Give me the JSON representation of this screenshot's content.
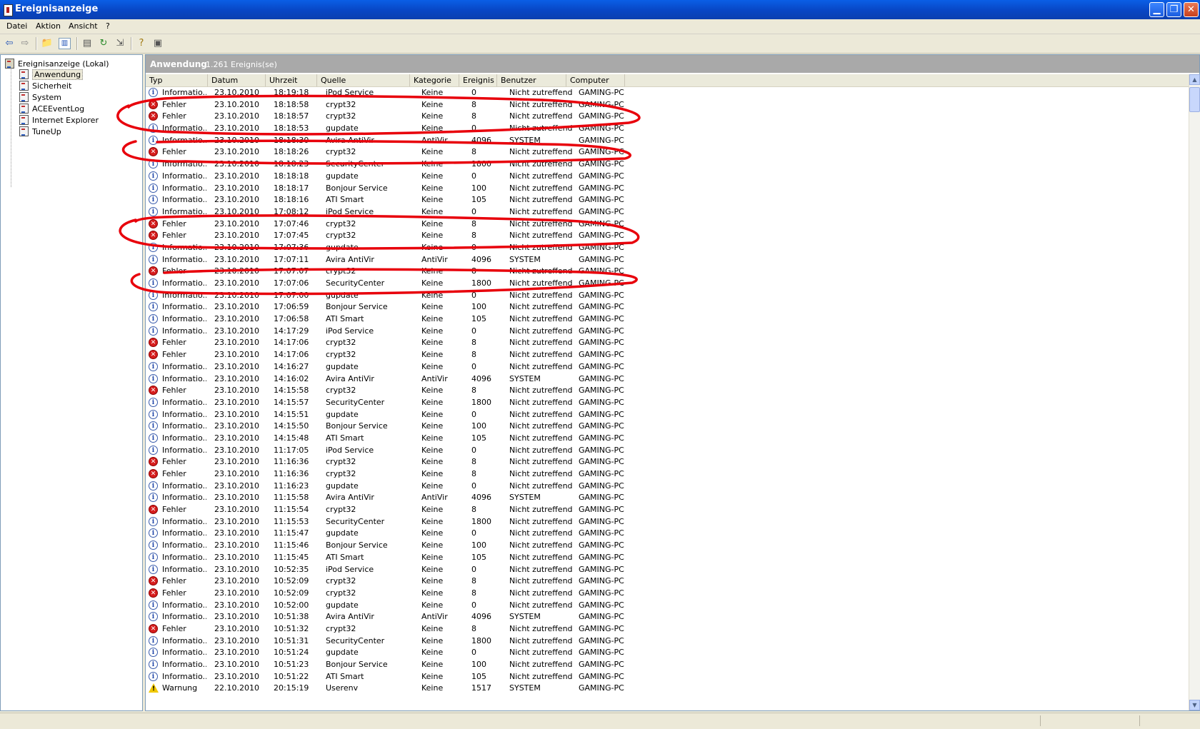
{
  "window": {
    "title": "Ereignisanzeige"
  },
  "menu": [
    "Datei",
    "Aktion",
    "Ansicht",
    "?"
  ],
  "tree": {
    "root": "Ereignisanzeige (Lokal)",
    "items": [
      "Anwendung",
      "Sicherheit",
      "System",
      "ACEEventLog",
      "Internet Explorer",
      "TuneUp"
    ],
    "selected": "Anwendung"
  },
  "panel": {
    "title": "Anwendung",
    "count": "1.261 Ereignis(se)"
  },
  "columns": [
    "Typ",
    "Datum",
    "Uhrzeit",
    "Quelle",
    "Kategorie",
    "Ereignis",
    "Benutzer",
    "Computer"
  ],
  "annotation": {
    "color": "#e8000b",
    "note": "hand-drawn red ellipses around Fehler rows"
  },
  "rows": [
    [
      "info",
      "Informatio...",
      "23.10.2010",
      "18:19:18",
      "iPod Service",
      "Keine",
      "0",
      "Nicht zutreffend",
      "GAMING-PC"
    ],
    [
      "err",
      "Fehler",
      "23.10.2010",
      "18:18:58",
      "crypt32",
      "Keine",
      "8",
      "Nicht zutreffend",
      "GAMING-PC"
    ],
    [
      "err",
      "Fehler",
      "23.10.2010",
      "18:18:57",
      "crypt32",
      "Keine",
      "8",
      "Nicht zutreffend",
      "GAMING-PC"
    ],
    [
      "info",
      "Informatio...",
      "23.10.2010",
      "18:18:53",
      "gupdate",
      "Keine",
      "0",
      "Nicht zutreffend",
      "GAMING-PC"
    ],
    [
      "info",
      "Informatio...",
      "23.10.2010",
      "18:18:30",
      "Avira AntiVir",
      "AntiVir",
      "4096",
      "SYSTEM",
      "GAMING-PC"
    ],
    [
      "err",
      "Fehler",
      "23.10.2010",
      "18:18:26",
      "crypt32",
      "Keine",
      "8",
      "Nicht zutreffend",
      "GAMING-PC"
    ],
    [
      "info",
      "Informatio...",
      "23.10.2010",
      "18:18:23",
      "SecurityCenter",
      "Keine",
      "1800",
      "Nicht zutreffend",
      "GAMING-PC"
    ],
    [
      "info",
      "Informatio...",
      "23.10.2010",
      "18:18:18",
      "gupdate",
      "Keine",
      "0",
      "Nicht zutreffend",
      "GAMING-PC"
    ],
    [
      "info",
      "Informatio...",
      "23.10.2010",
      "18:18:17",
      "Bonjour Service",
      "Keine",
      "100",
      "Nicht zutreffend",
      "GAMING-PC"
    ],
    [
      "info",
      "Informatio...",
      "23.10.2010",
      "18:18:16",
      "ATI Smart",
      "Keine",
      "105",
      "Nicht zutreffend",
      "GAMING-PC"
    ],
    [
      "info",
      "Informatio...",
      "23.10.2010",
      "17:08:12",
      "iPod Service",
      "Keine",
      "0",
      "Nicht zutreffend",
      "GAMING-PC"
    ],
    [
      "err",
      "Fehler",
      "23.10.2010",
      "17:07:46",
      "crypt32",
      "Keine",
      "8",
      "Nicht zutreffend",
      "GAMING-PC"
    ],
    [
      "err",
      "Fehler",
      "23.10.2010",
      "17:07:45",
      "crypt32",
      "Keine",
      "8",
      "Nicht zutreffend",
      "GAMING-PC"
    ],
    [
      "info",
      "Informatio...",
      "23.10.2010",
      "17:07:36",
      "gupdate",
      "Keine",
      "0",
      "Nicht zutreffend",
      "GAMING-PC"
    ],
    [
      "info",
      "Informatio...",
      "23.10.2010",
      "17:07:11",
      "Avira AntiVir",
      "AntiVir",
      "4096",
      "SYSTEM",
      "GAMING-PC"
    ],
    [
      "err",
      "Fehler",
      "23.10.2010",
      "17:07:07",
      "crypt32",
      "Keine",
      "8",
      "Nicht zutreffend",
      "GAMING-PC"
    ],
    [
      "info",
      "Informatio...",
      "23.10.2010",
      "17:07:06",
      "SecurityCenter",
      "Keine",
      "1800",
      "Nicht zutreffend",
      "GAMING-PC"
    ],
    [
      "info",
      "Informatio...",
      "23.10.2010",
      "17:07:00",
      "gupdate",
      "Keine",
      "0",
      "Nicht zutreffend",
      "GAMING-PC"
    ],
    [
      "info",
      "Informatio...",
      "23.10.2010",
      "17:06:59",
      "Bonjour Service",
      "Keine",
      "100",
      "Nicht zutreffend",
      "GAMING-PC"
    ],
    [
      "info",
      "Informatio...",
      "23.10.2010",
      "17:06:58",
      "ATI Smart",
      "Keine",
      "105",
      "Nicht zutreffend",
      "GAMING-PC"
    ],
    [
      "info",
      "Informatio...",
      "23.10.2010",
      "14:17:29",
      "iPod Service",
      "Keine",
      "0",
      "Nicht zutreffend",
      "GAMING-PC"
    ],
    [
      "err",
      "Fehler",
      "23.10.2010",
      "14:17:06",
      "crypt32",
      "Keine",
      "8",
      "Nicht zutreffend",
      "GAMING-PC"
    ],
    [
      "err",
      "Fehler",
      "23.10.2010",
      "14:17:06",
      "crypt32",
      "Keine",
      "8",
      "Nicht zutreffend",
      "GAMING-PC"
    ],
    [
      "info",
      "Informatio...",
      "23.10.2010",
      "14:16:27",
      "gupdate",
      "Keine",
      "0",
      "Nicht zutreffend",
      "GAMING-PC"
    ],
    [
      "info",
      "Informatio...",
      "23.10.2010",
      "14:16:02",
      "Avira AntiVir",
      "AntiVir",
      "4096",
      "SYSTEM",
      "GAMING-PC"
    ],
    [
      "err",
      "Fehler",
      "23.10.2010",
      "14:15:58",
      "crypt32",
      "Keine",
      "8",
      "Nicht zutreffend",
      "GAMING-PC"
    ],
    [
      "info",
      "Informatio...",
      "23.10.2010",
      "14:15:57",
      "SecurityCenter",
      "Keine",
      "1800",
      "Nicht zutreffend",
      "GAMING-PC"
    ],
    [
      "info",
      "Informatio...",
      "23.10.2010",
      "14:15:51",
      "gupdate",
      "Keine",
      "0",
      "Nicht zutreffend",
      "GAMING-PC"
    ],
    [
      "info",
      "Informatio...",
      "23.10.2010",
      "14:15:50",
      "Bonjour Service",
      "Keine",
      "100",
      "Nicht zutreffend",
      "GAMING-PC"
    ],
    [
      "info",
      "Informatio...",
      "23.10.2010",
      "14:15:48",
      "ATI Smart",
      "Keine",
      "105",
      "Nicht zutreffend",
      "GAMING-PC"
    ],
    [
      "info",
      "Informatio...",
      "23.10.2010",
      "11:17:05",
      "iPod Service",
      "Keine",
      "0",
      "Nicht zutreffend",
      "GAMING-PC"
    ],
    [
      "err",
      "Fehler",
      "23.10.2010",
      "11:16:36",
      "crypt32",
      "Keine",
      "8",
      "Nicht zutreffend",
      "GAMING-PC"
    ],
    [
      "err",
      "Fehler",
      "23.10.2010",
      "11:16:36",
      "crypt32",
      "Keine",
      "8",
      "Nicht zutreffend",
      "GAMING-PC"
    ],
    [
      "info",
      "Informatio...",
      "23.10.2010",
      "11:16:23",
      "gupdate",
      "Keine",
      "0",
      "Nicht zutreffend",
      "GAMING-PC"
    ],
    [
      "info",
      "Informatio...",
      "23.10.2010",
      "11:15:58",
      "Avira AntiVir",
      "AntiVir",
      "4096",
      "SYSTEM",
      "GAMING-PC"
    ],
    [
      "err",
      "Fehler",
      "23.10.2010",
      "11:15:54",
      "crypt32",
      "Keine",
      "8",
      "Nicht zutreffend",
      "GAMING-PC"
    ],
    [
      "info",
      "Informatio...",
      "23.10.2010",
      "11:15:53",
      "SecurityCenter",
      "Keine",
      "1800",
      "Nicht zutreffend",
      "GAMING-PC"
    ],
    [
      "info",
      "Informatio...",
      "23.10.2010",
      "11:15:47",
      "gupdate",
      "Keine",
      "0",
      "Nicht zutreffend",
      "GAMING-PC"
    ],
    [
      "info",
      "Informatio...",
      "23.10.2010",
      "11:15:46",
      "Bonjour Service",
      "Keine",
      "100",
      "Nicht zutreffend",
      "GAMING-PC"
    ],
    [
      "info",
      "Informatio...",
      "23.10.2010",
      "11:15:45",
      "ATI Smart",
      "Keine",
      "105",
      "Nicht zutreffend",
      "GAMING-PC"
    ],
    [
      "info",
      "Informatio...",
      "23.10.2010",
      "10:52:35",
      "iPod Service",
      "Keine",
      "0",
      "Nicht zutreffend",
      "GAMING-PC"
    ],
    [
      "err",
      "Fehler",
      "23.10.2010",
      "10:52:09",
      "crypt32",
      "Keine",
      "8",
      "Nicht zutreffend",
      "GAMING-PC"
    ],
    [
      "err",
      "Fehler",
      "23.10.2010",
      "10:52:09",
      "crypt32",
      "Keine",
      "8",
      "Nicht zutreffend",
      "GAMING-PC"
    ],
    [
      "info",
      "Informatio...",
      "23.10.2010",
      "10:52:00",
      "gupdate",
      "Keine",
      "0",
      "Nicht zutreffend",
      "GAMING-PC"
    ],
    [
      "info",
      "Informatio...",
      "23.10.2010",
      "10:51:38",
      "Avira AntiVir",
      "AntiVir",
      "4096",
      "SYSTEM",
      "GAMING-PC"
    ],
    [
      "err",
      "Fehler",
      "23.10.2010",
      "10:51:32",
      "crypt32",
      "Keine",
      "8",
      "Nicht zutreffend",
      "GAMING-PC"
    ],
    [
      "info",
      "Informatio...",
      "23.10.2010",
      "10:51:31",
      "SecurityCenter",
      "Keine",
      "1800",
      "Nicht zutreffend",
      "GAMING-PC"
    ],
    [
      "info",
      "Informatio...",
      "23.10.2010",
      "10:51:24",
      "gupdate",
      "Keine",
      "0",
      "Nicht zutreffend",
      "GAMING-PC"
    ],
    [
      "info",
      "Informatio...",
      "23.10.2010",
      "10:51:23",
      "Bonjour Service",
      "Keine",
      "100",
      "Nicht zutreffend",
      "GAMING-PC"
    ],
    [
      "info",
      "Informatio...",
      "23.10.2010",
      "10:51:22",
      "ATI Smart",
      "Keine",
      "105",
      "Nicht zutreffend",
      "GAMING-PC"
    ],
    [
      "warn",
      "Warnung",
      "22.10.2010",
      "20:15:19",
      "Userenv",
      "Keine",
      "1517",
      "SYSTEM",
      "GAMING-PC"
    ]
  ]
}
